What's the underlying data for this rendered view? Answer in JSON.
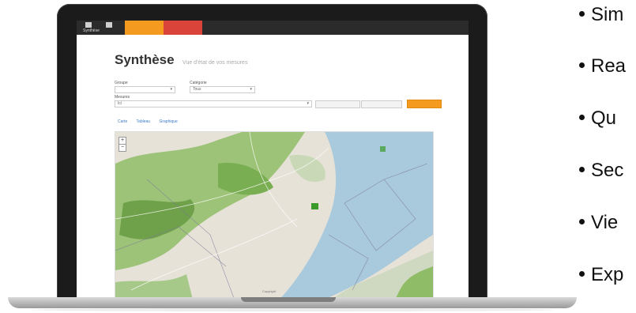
{
  "app": {
    "nav_icons": [
      {
        "label": "Synthèse",
        "icon": "grid-icon"
      },
      {
        "label": "",
        "icon": "chart-icon"
      }
    ],
    "nav_buttons": [
      "",
      ""
    ]
  },
  "page": {
    "title": "Synthèse",
    "subtitle": "Vue d'état de vos mesures",
    "filters": {
      "group_label": "Groupe",
      "group_value": "",
      "status_label": "Catégorie",
      "status_value": "Tous",
      "measure_label": "Mesures",
      "measure_value": "Ici"
    },
    "buttons": {
      "btn1": "",
      "btn2": "",
      "apply": ""
    },
    "tabs": [
      "Carte",
      "Tableau",
      "Graphique"
    ],
    "footer": "Copyright"
  },
  "bullets": [
    "Sim",
    "Rea",
    "Qu",
    "Sec",
    "Vie",
    "Exp"
  ],
  "colors": {
    "accent_orange": "#f39a1f",
    "accent_red": "#d9433a",
    "topbar": "#2b2b2b",
    "water": "#a9c9dd",
    "forest": "#7fae58"
  }
}
